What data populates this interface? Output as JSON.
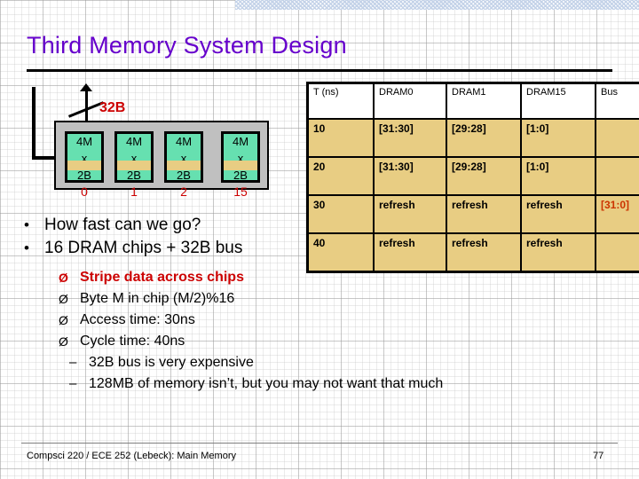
{
  "slide": {
    "title": "Third Memory System Design",
    "accent_purple": "#6600CC",
    "accent_red": "#CC0000",
    "chip_green": "#66E0B0",
    "table_tan": "#E8CD83",
    "container_gray": "#C0C0C0"
  },
  "diagram": {
    "bus_label": "32B",
    "ellipsis": "…",
    "chips": [
      {
        "line1": "4M",
        "line2": "x",
        "line3": "2B",
        "index": "0"
      },
      {
        "line1": "4M",
        "line2": "x",
        "line3": "2B",
        "index": "1"
      },
      {
        "line1": "4M",
        "line2": "x",
        "line3": "2B",
        "index": "2"
      },
      {
        "line1": "4M",
        "line2": "x",
        "line3": "2B",
        "index": "15"
      }
    ]
  },
  "table": {
    "headers": [
      "T (ns)",
      "DRAM0",
      "DRAM1",
      "DRAM15",
      "Bus"
    ],
    "rows": [
      {
        "t": "10",
        "dram0": "[31:30]",
        "dram1": "[29:28]",
        "dram15": "[1:0]",
        "bus": ""
      },
      {
        "t": "20",
        "dram0": "[31:30]",
        "dram1": "[29:28]",
        "dram15": "[1:0]",
        "bus": ""
      },
      {
        "t": "30",
        "dram0": "refresh",
        "dram1": "refresh",
        "dram15": "refresh",
        "bus": "[31:0]"
      },
      {
        "t": "40",
        "dram0": "refresh",
        "dram1": "refresh",
        "dram15": "refresh",
        "bus": ""
      }
    ]
  },
  "bullets": {
    "level1": [
      {
        "marker": "•",
        "text": "How fast can we go?"
      },
      {
        "marker": "•",
        "text": "16 DRAM chips + 32B bus"
      }
    ],
    "level2": [
      {
        "marker": "Ø",
        "text": "Stripe data across chips"
      },
      {
        "marker": "Ø",
        "text": "Byte M in chip (M/2)%16"
      },
      {
        "marker": "Ø",
        "text": "Access time: 30ns"
      },
      {
        "marker": "Ø",
        "text": "Cycle time: 40ns"
      }
    ],
    "level3": [
      {
        "marker": "–",
        "text": "32B bus is very expensive"
      },
      {
        "marker": "–",
        "text": "128MB of memory isn’t, but you may not want that much"
      }
    ]
  },
  "footer": {
    "text": "Compsci 220 / ECE 252 (Lebeck): Main Memory",
    "page": "77"
  }
}
